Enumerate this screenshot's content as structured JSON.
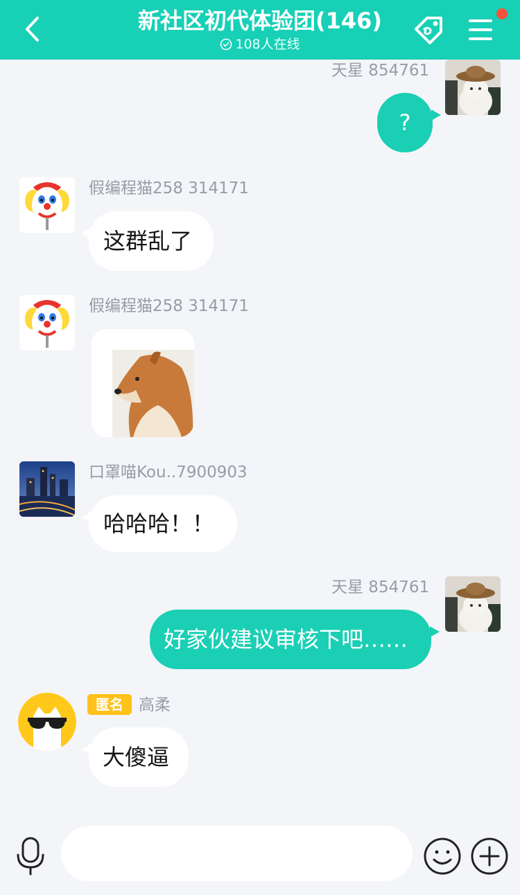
{
  "header": {
    "title": "新社区初代体验团(146)",
    "online": "108人在线",
    "accent_color": "#17d0b6",
    "back_icon": "chevron-left-icon",
    "tag_icon": "tag-icon",
    "menu_icon": "menu-icon",
    "notification_color": "#f5533d"
  },
  "messages": [
    {
      "side": "out",
      "sender": "天星 854761",
      "text": "?"
    },
    {
      "side": "in",
      "sender": "假编程猫258 314171",
      "text": "这群乱了"
    },
    {
      "side": "in",
      "sender": "假编程猫258 314171",
      "type": "image",
      "image_desc": "doge-sticker"
    },
    {
      "side": "in",
      "sender": "口罩喵Kou..7900903",
      "text": "哈哈哈！！"
    },
    {
      "side": "out",
      "sender": "天星 854761",
      "text": "好家伙建议审核下吧……"
    },
    {
      "side": "in",
      "badge": "匿名",
      "sender": "高柔",
      "text": "大傻逼"
    }
  ],
  "composer": {
    "placeholder": "",
    "mic_icon": "microphone-icon",
    "emoji_icon": "emoji-icon",
    "plus_icon": "plus-icon"
  }
}
